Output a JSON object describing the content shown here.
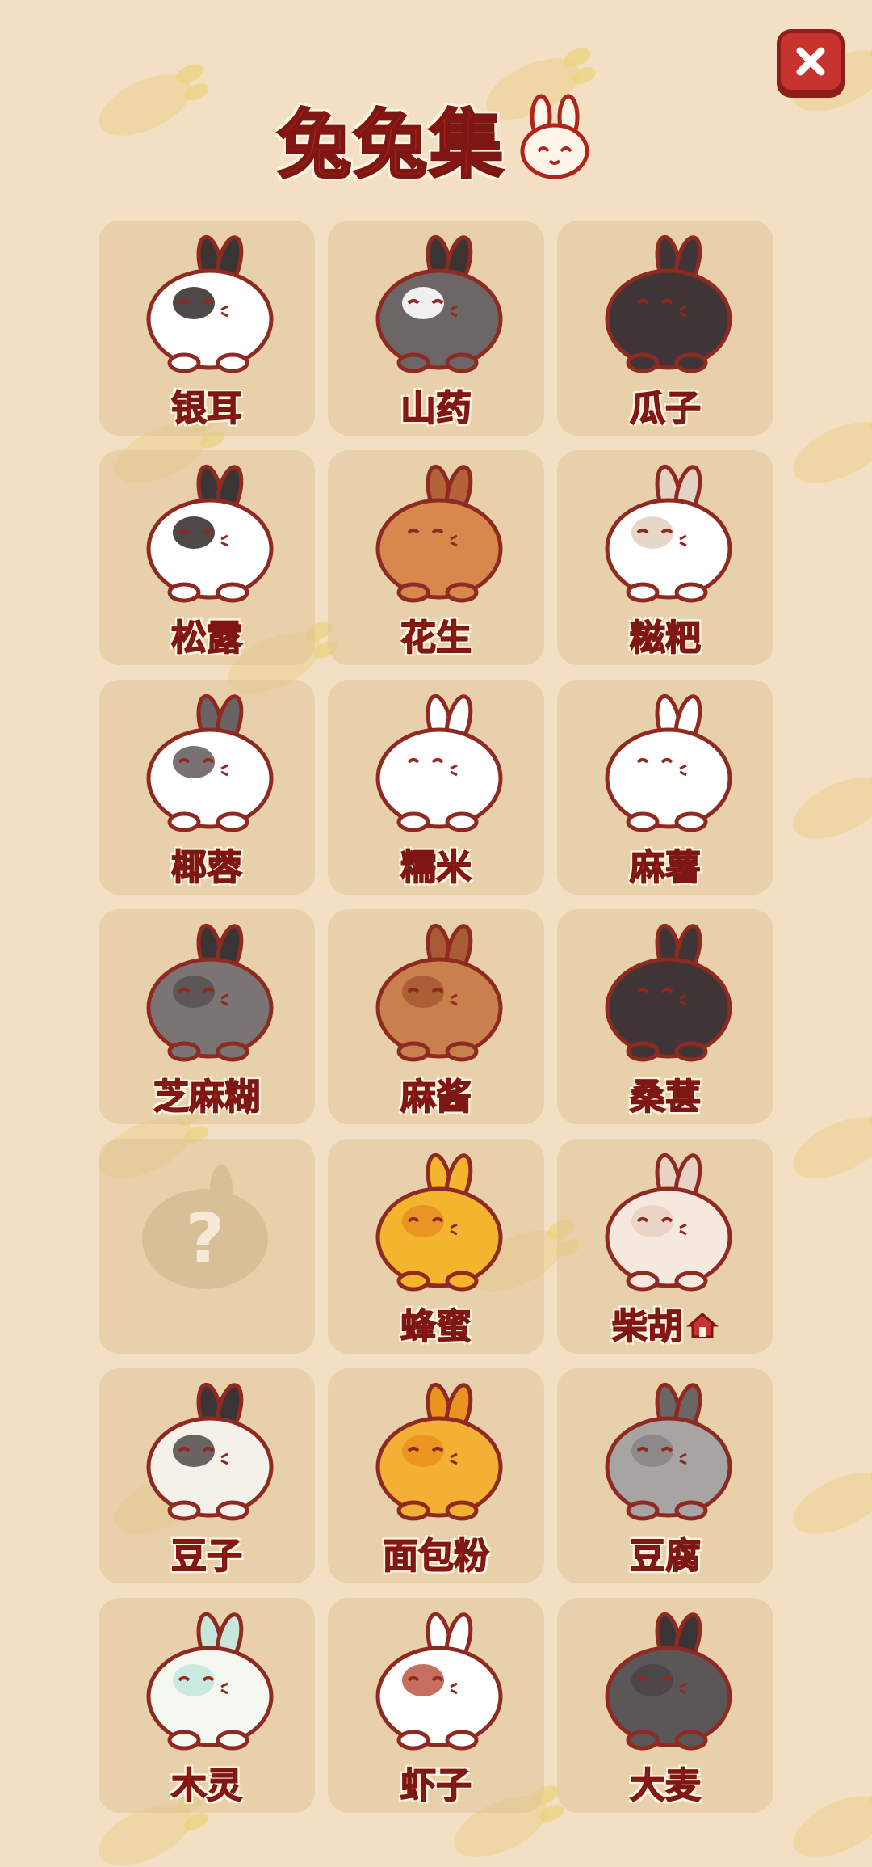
{
  "title": "兔兔集",
  "title_icon": "bunny-face-icon",
  "close_icon": "close-icon",
  "colors": {
    "background": "#f3dfc4",
    "card": "#e3cb9f",
    "accent_red": "#b0241e",
    "outline_dark": "#7e1612",
    "carrot_pattern": "#ecd199"
  },
  "bunnies": [
    {
      "name": "银耳",
      "body": "#ffffff",
      "patch": "#3b3434",
      "ears": "#3b3434",
      "locked": false
    },
    {
      "name": "山药",
      "body": "#6d6667",
      "patch": "#ffffff",
      "ears": "#3b3434",
      "locked": false
    },
    {
      "name": "瓜子",
      "body": "#3f3536",
      "patch": "#3f3536",
      "ears": "#3f3536",
      "locked": false
    },
    {
      "name": "松露",
      "body": "#ffffff",
      "patch": "#3b3434",
      "ears": "#3b3434",
      "locked": false
    },
    {
      "name": "花生",
      "body": "#d8884d",
      "patch": "#d8884d",
      "ears": "#b46238",
      "locked": false
    },
    {
      "name": "糍粑",
      "body": "#ffffff",
      "patch": "#e3d3c3",
      "ears": "#e3d3c3",
      "locked": false
    },
    {
      "name": "椰蓉",
      "body": "#ffffff",
      "patch": "#6a6365",
      "ears": "#6a6365",
      "locked": false
    },
    {
      "name": "糯米",
      "body": "#ffffff",
      "patch": "#ffffff",
      "ears": "#ffffff",
      "locked": false
    },
    {
      "name": "麻薯",
      "body": "#ffffff",
      "patch": "#ffffff",
      "ears": "#ffffff",
      "locked": false
    },
    {
      "name": "芝麻糊",
      "body": "#7b7475",
      "patch": "#5a5354",
      "ears": "#3b3434",
      "locked": false
    },
    {
      "name": "麻酱",
      "body": "#c8804d",
      "patch": "#a85b35",
      "ears": "#a85b35",
      "locked": false
    },
    {
      "name": "桑葚",
      "body": "#3f3536",
      "patch": "#3f3536",
      "ears": "#3f3536",
      "locked": false
    },
    {
      "name": "?",
      "body": "#d7c097",
      "patch": "#d7c097",
      "ears": "#d7c097",
      "locked": true
    },
    {
      "name": "蜂蜜",
      "body": "#f3b42e",
      "patch": "#e79124",
      "ears": "#f3b42e",
      "locked": false
    },
    {
      "name": "柴胡",
      "body": "#f6e8de",
      "patch": "#e8d2c4",
      "ears": "#e8d2c4",
      "locked": false,
      "home": true
    },
    {
      "name": "豆子",
      "body": "#f4f0ea",
      "patch": "#5a5354",
      "ears": "#3b3434",
      "locked": false
    },
    {
      "name": "面包粉",
      "body": "#f4b034",
      "patch": "#e9941f",
      "ears": "#e9941f",
      "locked": false
    },
    {
      "name": "豆腐",
      "body": "#a7a4a4",
      "patch": "#8a8686",
      "ears": "#6b6666",
      "locked": false
    },
    {
      "name": "木灵",
      "body": "#f5f7f1",
      "patch": "#c6e8dc",
      "ears": "#c6e8dc",
      "locked": false
    },
    {
      "name": "虾子",
      "body": "#ffffff",
      "patch": "#c15e4e",
      "ears": "#ffffff",
      "locked": false
    },
    {
      "name": "大麦",
      "body": "#5b5657",
      "patch": "#4a4546",
      "ears": "#3b3434",
      "locked": false
    }
  ]
}
